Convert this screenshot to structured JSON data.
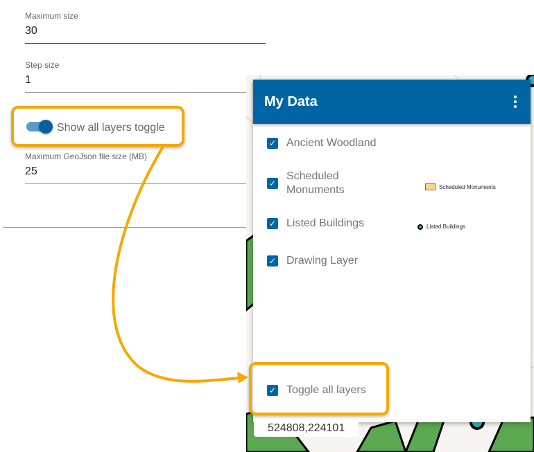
{
  "settings": {
    "max_size": {
      "label": "Maximum size",
      "value": "30"
    },
    "step_size": {
      "label": "Step size",
      "value": "1"
    },
    "show_all_toggle": {
      "label": "Show all layers toggle",
      "on": true
    },
    "max_geojson": {
      "label": "Maximum GeoJson file size (MB)",
      "value": "25"
    }
  },
  "panel": {
    "title": "My Data",
    "layers": [
      {
        "label": "Ancient Woodland",
        "checked": true
      },
      {
        "label": "Scheduled Monuments",
        "checked": true
      },
      {
        "label": "Listed Buildings",
        "checked": true
      },
      {
        "label": "Drawing Layer",
        "checked": true
      }
    ],
    "legend": {
      "scheduled": "Scheduled Monuments",
      "listed": "Listed Buildings"
    },
    "toggle_all": {
      "label": "Toggle all layers",
      "checked": true
    }
  },
  "coordinates": "524808,224101",
  "colors": {
    "header": "#0066a3",
    "highlight": "#f5a800",
    "woodland": "#5aa84f",
    "monument": "#fcd58a",
    "listed": "#2ab6c8"
  }
}
